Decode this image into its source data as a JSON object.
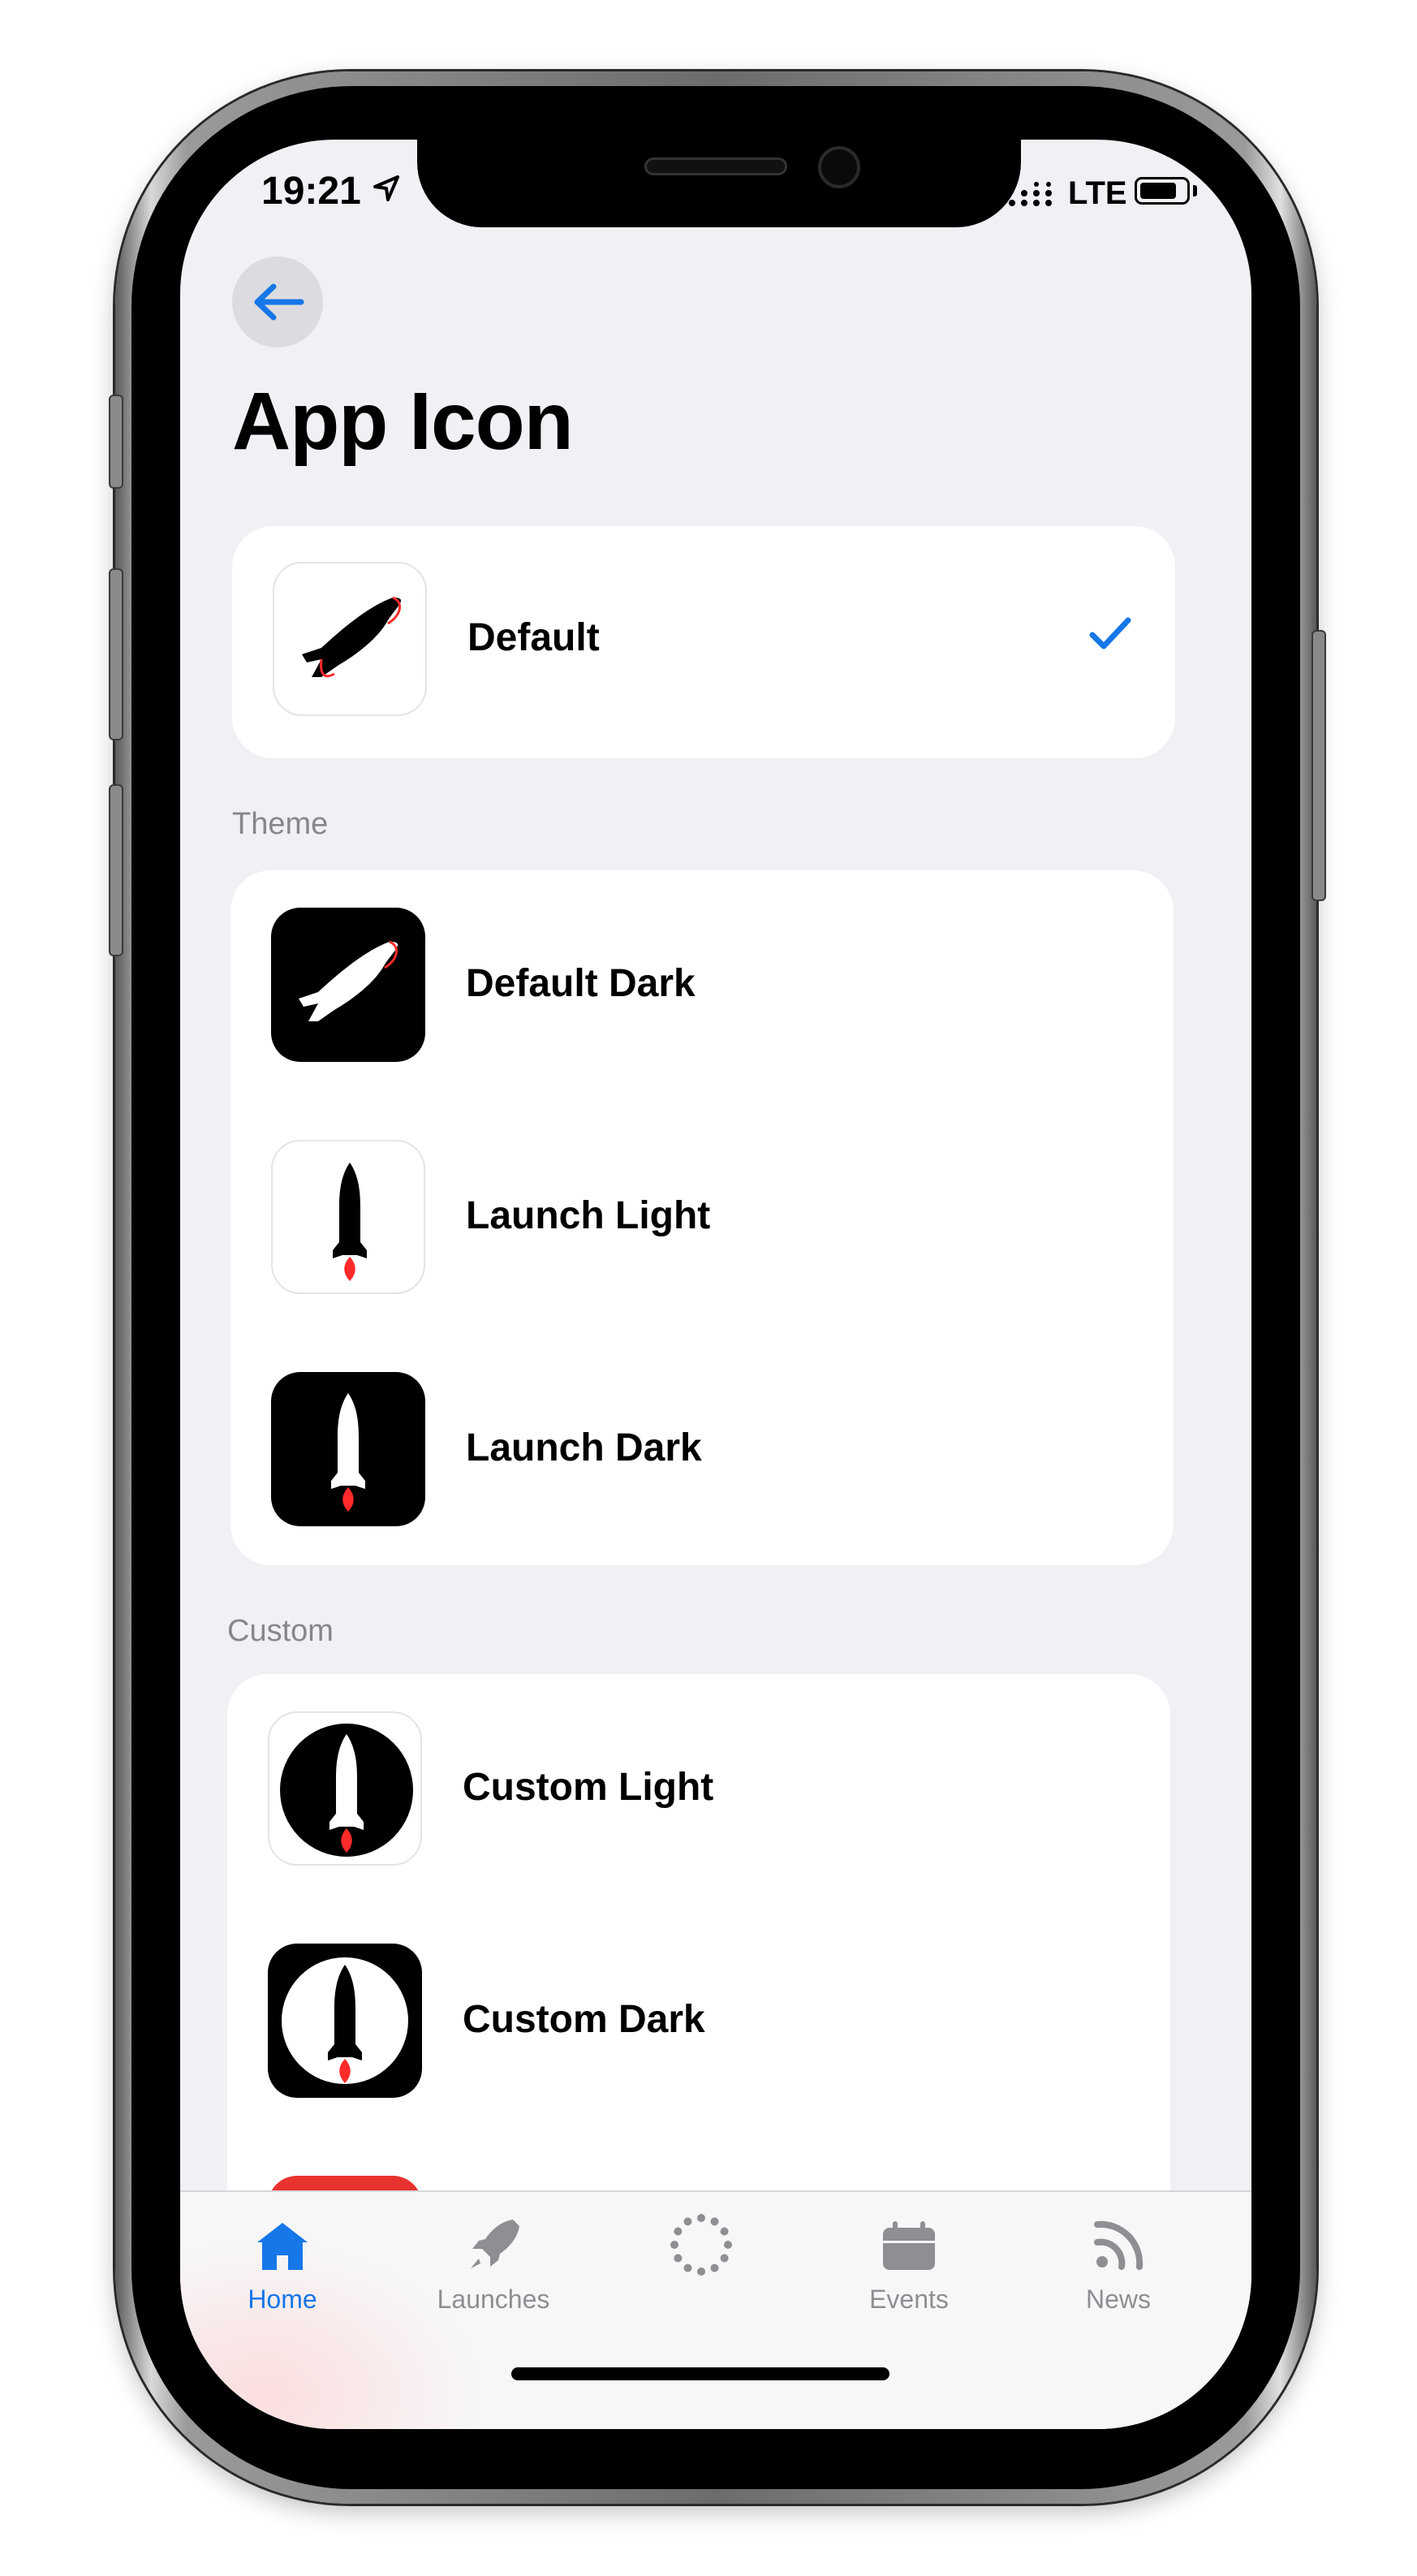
{
  "status_bar": {
    "time": "19:21",
    "network": "LTE"
  },
  "header": {
    "title": "App Icon"
  },
  "default_section": {
    "items": [
      {
        "label": "Default",
        "selected": true
      }
    ]
  },
  "theme_section": {
    "header": "Theme",
    "items": [
      {
        "label": "Default Dark"
      },
      {
        "label": "Launch Light"
      },
      {
        "label": "Launch Dark"
      }
    ]
  },
  "custom_section": {
    "header": "Custom",
    "items": [
      {
        "label": "Custom Light"
      },
      {
        "label": "Custom Dark"
      }
    ]
  },
  "tab_bar": {
    "tabs": [
      {
        "label": "Home",
        "icon": "house-icon",
        "active": true
      },
      {
        "label": "Launches",
        "icon": "rocket-icon",
        "active": false
      },
      {
        "label": "",
        "icon": "dotted-circle-icon",
        "active": false
      },
      {
        "label": "Events",
        "icon": "calendar-icon",
        "active": false
      },
      {
        "label": "News",
        "icon": "rss-icon",
        "active": false
      }
    ]
  },
  "colors": {
    "accent": "#1677e8",
    "background": "#f0f0f5",
    "card": "#ffffff",
    "flame": "#ff2a2a"
  }
}
